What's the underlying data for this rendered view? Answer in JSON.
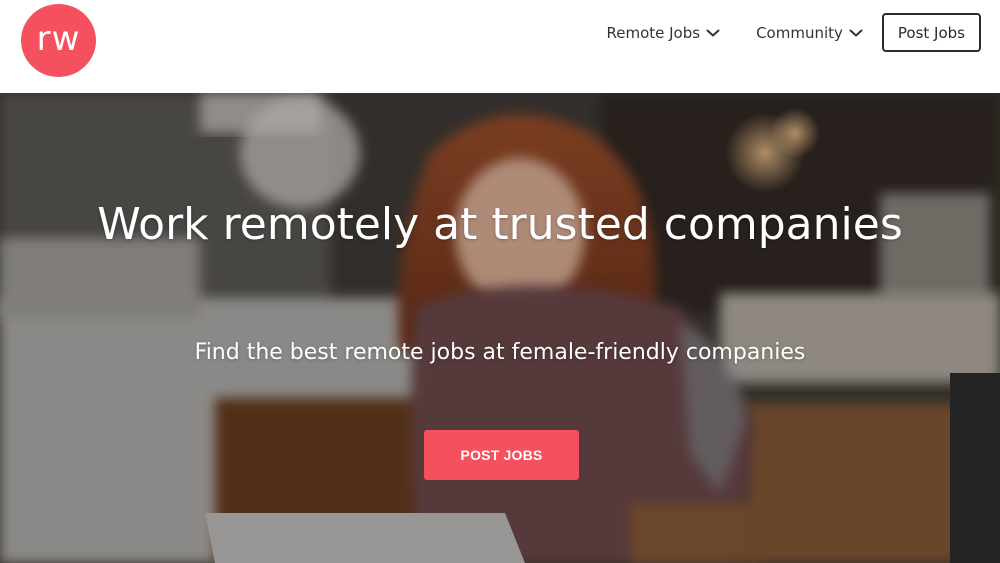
{
  "brand": {
    "logo_text": "rw",
    "color": "#f5505e"
  },
  "nav": {
    "items": [
      {
        "label": "Remote Jobs",
        "icon": "chevron-down-icon"
      },
      {
        "label": "Community",
        "icon": "chevron-down-icon"
      }
    ],
    "cta_label": "Post Jobs"
  },
  "hero": {
    "title": "Work remotely at trusted companies",
    "subtitle": "Find the best remote jobs at female-friendly companies",
    "cta_label": "POST JOBS",
    "cta_color": "#f5505e"
  }
}
